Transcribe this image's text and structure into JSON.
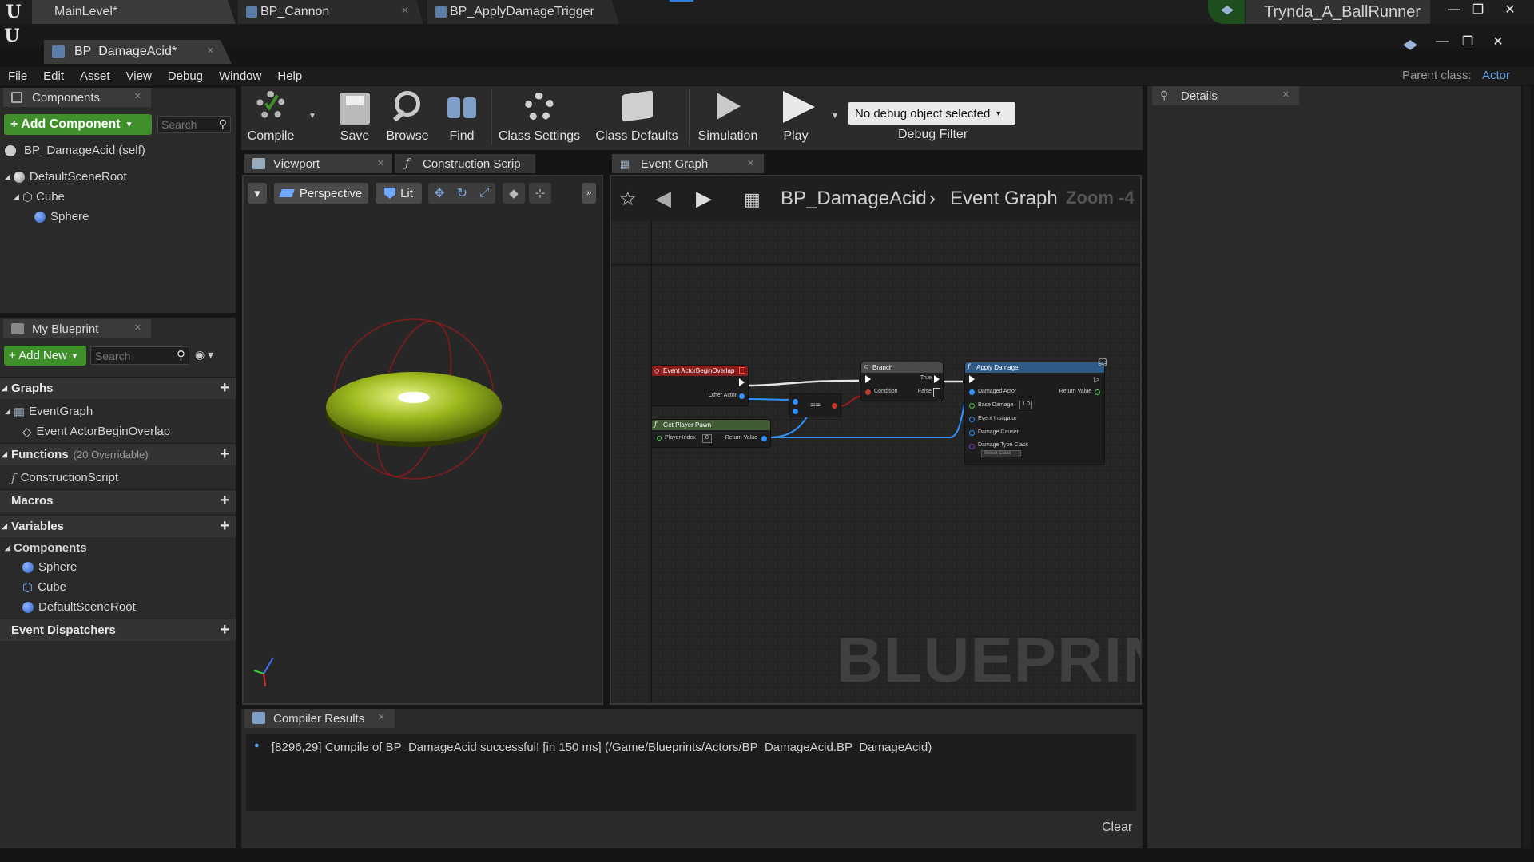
{
  "app": {
    "tabs": [
      {
        "label": "MainLevel*"
      },
      {
        "label": "BP_Cannon"
      },
      {
        "label": "BP_ApplyDamageTrigger"
      }
    ],
    "user": "Trynda_A_BallRunner",
    "doc_tab": "BP_DamageAcid*",
    "parent_class_label": "Parent class:",
    "parent_class_value": "Actor"
  },
  "menu": [
    "File",
    "Edit",
    "Asset",
    "View",
    "Debug",
    "Window",
    "Help"
  ],
  "components_panel": {
    "tab": "Components",
    "add_button": "+ Add Component",
    "search_placeholder": "Search",
    "self_item": "BP_DamageAcid (self)",
    "tree": [
      "DefaultSceneRoot",
      "Cube",
      "Sphere"
    ]
  },
  "my_blueprint": {
    "tab": "My Blueprint",
    "add_new": "+ Add New",
    "search_placeholder": "Search",
    "graphs_label": "Graphs",
    "event_graph": "EventGraph",
    "event_item": "Event ActorBeginOverlap",
    "functions_label": "Functions",
    "functions_count": "(20 Overridable)",
    "construction_script": "ConstructionScript",
    "macros_label": "Macros",
    "variables_label": "Variables",
    "components_label": "Components",
    "components": [
      "Sphere",
      "Cube",
      "DefaultSceneRoot"
    ],
    "event_dispatchers_label": "Event Dispatchers"
  },
  "toolbar": {
    "compile": "Compile",
    "save": "Save",
    "browse": "Browse",
    "find": "Find",
    "class_settings": "Class Settings",
    "class_defaults": "Class Defaults",
    "simulation": "Simulation",
    "play": "Play",
    "debug_select": "No debug object selected",
    "debug_filter": "Debug Filter"
  },
  "editor_tabs": {
    "viewport": "Viewport",
    "construction": "Construction Scrip",
    "event_graph": "Event Graph"
  },
  "viewport": {
    "perspective": "Perspective",
    "lit": "Lit"
  },
  "graph": {
    "breadcrumb_bp": "BP_DamageAcid",
    "breadcrumb_graph": "Event Graph",
    "zoom": "Zoom -4",
    "watermark": "BLUEPRINT",
    "nodes": {
      "event_title": "Event ActorBeginOverlap",
      "other_actor": "Other Actor",
      "branch_title": "Branch",
      "condition": "Condition",
      "true_pin": "True",
      "false_pin": "False",
      "apply_title": "Apply Damage",
      "damaged_actor": "Damaged Actor",
      "base_damage": "Base Damage",
      "base_damage_val": "1.0",
      "event_instigator": "Event Instigator",
      "damage_causer": "Damage Causer",
      "damage_type_class": "Damage Type Class",
      "select_class": "Select Class",
      "return_value": "Return Value",
      "get_player_pawn": "Get Player Pawn",
      "player_index": "Player Index",
      "player_index_val": "0",
      "equals": "=="
    }
  },
  "details": {
    "tab": "Details"
  },
  "compiler": {
    "tab": "Compiler Results",
    "message": "[8296,29] Compile of BP_DamageAcid successful! [in 150 ms] (/Game/Blueprints/Actors/BP_DamageAcid.BP_DamageAcid)",
    "clear": "Clear"
  },
  "colors": {
    "accent_green": "#3f8f2a",
    "exec_red": "#8a1c1c",
    "branch_gray": "#4a4a4a",
    "apply_blue": "#2f5a86",
    "pawn_green": "#3f5a34"
  }
}
